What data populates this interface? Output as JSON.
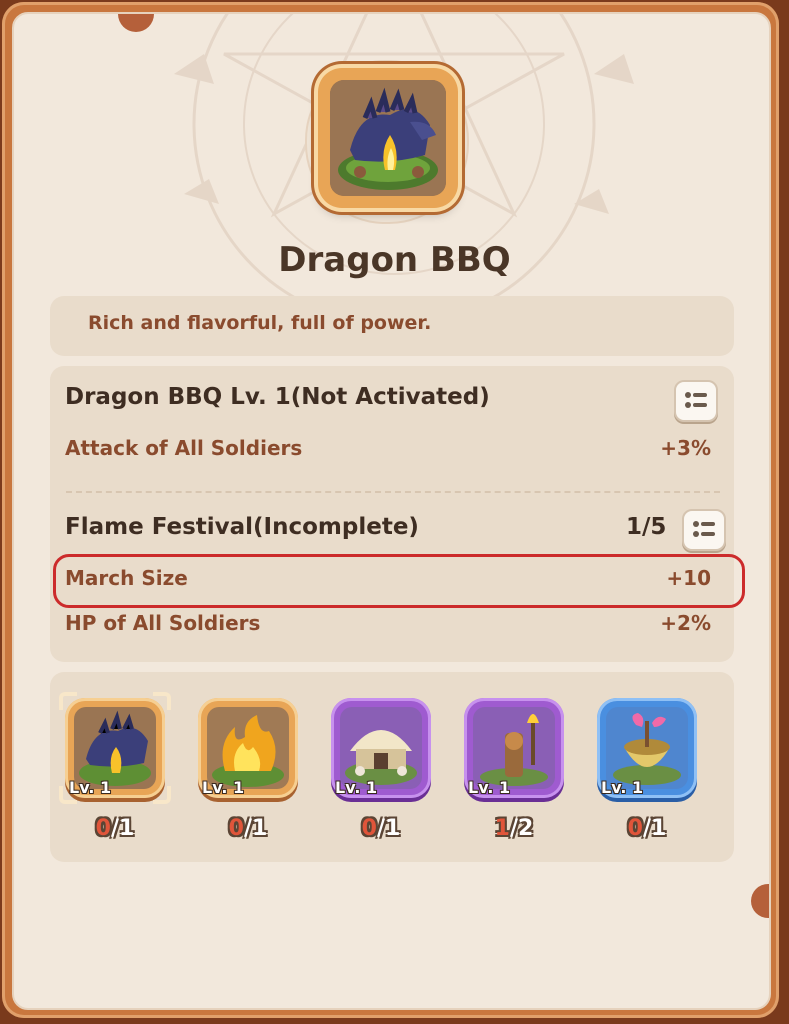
{
  "item": {
    "title": "Dragon BBQ",
    "description": "Rich and flavorful, full of power."
  },
  "level_effect": {
    "heading": "Dragon BBQ Lv. 1(Not Activated)",
    "stats": [
      {
        "label": "Attack of All Soldiers",
        "value": "+3%"
      }
    ]
  },
  "set_bonus": {
    "heading": "Flame Festival(Incomplete)",
    "progress": "1/5",
    "stats": [
      {
        "label": "March Size",
        "value": "+10"
      },
      {
        "label": "HP of All Soldiers",
        "value": "+2%"
      }
    ]
  },
  "set_items": [
    {
      "level": "Lv. 1",
      "have": "0",
      "need": "/1",
      "frame": "orange",
      "icon": "dragon-bbq-icon",
      "selected": true
    },
    {
      "level": "Lv. 1",
      "have": "0",
      "need": "/1",
      "frame": "orange",
      "icon": "bonfire-icon",
      "selected": false
    },
    {
      "level": "Lv. 1",
      "have": "0",
      "need": "/1",
      "frame": "purple",
      "icon": "bone-hut-icon",
      "selected": false
    },
    {
      "level": "Lv. 1",
      "have": "1",
      "need": "/2",
      "frame": "purple",
      "icon": "torch-totem-icon",
      "selected": false
    },
    {
      "level": "Lv. 1",
      "have": "0",
      "need": "/1",
      "frame": "blue",
      "icon": "cauldron-icon",
      "selected": false
    }
  ],
  "colors": {
    "frame": "#c9773e",
    "panel": "#f2e8dc",
    "card": "#e9dccb",
    "stat_text": "#8a4b2e",
    "highlight": "#cc2b2b"
  }
}
